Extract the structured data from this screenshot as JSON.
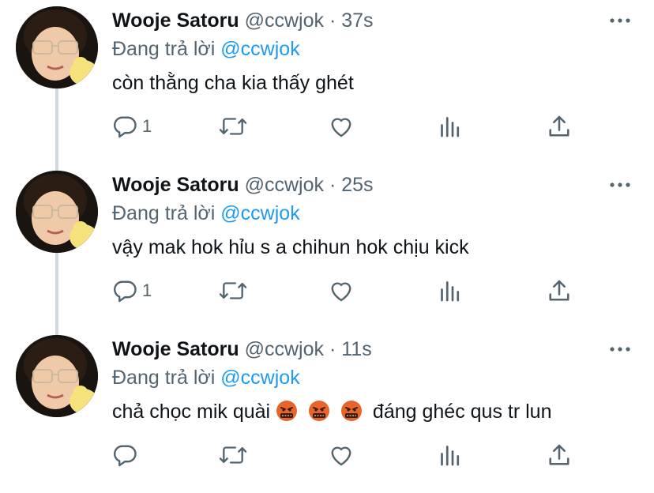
{
  "tweets": [
    {
      "name": "Wooje Satoru",
      "handle": "@ccwjok",
      "separator": "·",
      "time": "37s",
      "reply_prefix": "Đang trả lời",
      "reply_mention": "@ccwjok",
      "text": "còn thằng cha kia thấy ghét",
      "reply_count": "1",
      "emojis": []
    },
    {
      "name": "Wooje Satoru",
      "handle": "@ccwjok",
      "separator": "·",
      "time": "25s",
      "reply_prefix": "Đang trả lời",
      "reply_mention": "@ccwjok",
      "text": "vậy mak hok hỉu s a chihun hok chịu kick",
      "reply_count": "1",
      "emojis": []
    },
    {
      "name": "Wooje Satoru",
      "handle": "@ccwjok",
      "separator": "·",
      "time": "11s",
      "reply_prefix": "Đang trả lời",
      "reply_mention": "@ccwjok",
      "text_before": "chả chọc mik quài",
      "text_after": "đáng ghéc qus tr lun",
      "reply_count": "",
      "emojis": [
        "face-with-symbols-on-mouth",
        "face-with-symbols-on-mouth",
        "face-with-symbols-on-mouth"
      ]
    }
  ],
  "icons": {
    "reply": "reply-icon",
    "retweet": "retweet-icon",
    "like": "like-icon",
    "analytics": "analytics-icon",
    "share": "share-icon",
    "more": "more-icon"
  },
  "colors": {
    "text": "#0f1419",
    "secondary": "#536471",
    "mention": "#1d9bf0",
    "thread_line": "#cfd9de",
    "emoji": "#e8652a"
  }
}
